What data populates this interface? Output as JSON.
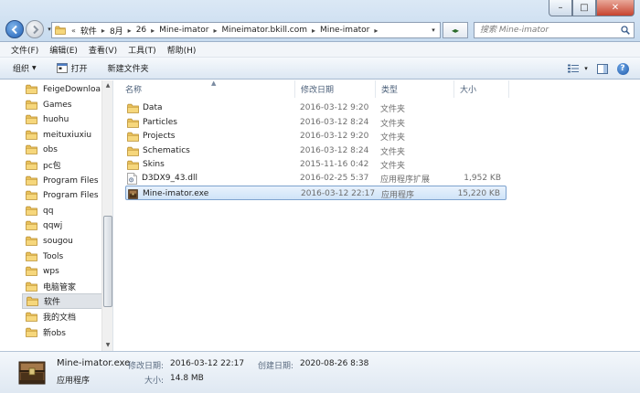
{
  "window": {
    "controls": {
      "minimize": "–",
      "maximize": "□",
      "close": "✕"
    }
  },
  "address": {
    "overflow": "«",
    "crumbs": [
      "软件",
      "8月",
      "26",
      "Mine-imator",
      "Mineimator.bkill.com",
      "Mine-imator"
    ],
    "separator": "▸",
    "dropdown": "▾"
  },
  "refresh": {
    "symbol": "◂▸"
  },
  "search": {
    "placeholder": "搜索 Mine-imator"
  },
  "menus": [
    "文件(F)",
    "编辑(E)",
    "查看(V)",
    "工具(T)",
    "帮助(H)"
  ],
  "toolbar": {
    "organize": "组织",
    "open": "打开",
    "new_folder": "新建文件夹",
    "help": "?",
    "views_dropdown": "▾"
  },
  "nav": {
    "items": [
      "FeigeDownloa",
      "Games",
      "huohu",
      "meituxiuxiu",
      "obs",
      "pc包",
      "Program Files",
      "Program Files",
      "qq",
      "qqwj",
      "sougou",
      "Tools",
      "wps",
      "电脑管家",
      "软件",
      "我的文档",
      "新obs"
    ],
    "selected_index": 14,
    "scroll_up": "▲",
    "scroll_down": "▼"
  },
  "columns": {
    "name": "名称",
    "date": "修改日期",
    "type": "类型",
    "size": "大小",
    "sort_indicator": "▲"
  },
  "files": [
    {
      "name": "Data",
      "date": "2016-03-12 9:20",
      "type": "文件夹",
      "size": "",
      "icon": "folder-icon"
    },
    {
      "name": "Particles",
      "date": "2016-03-12 8:24",
      "type": "文件夹",
      "size": "",
      "icon": "folder-icon"
    },
    {
      "name": "Projects",
      "date": "2016-03-12 9:20",
      "type": "文件夹",
      "size": "",
      "icon": "folder-icon"
    },
    {
      "name": "Schematics",
      "date": "2016-03-12 8:24",
      "type": "文件夹",
      "size": "",
      "icon": "folder-icon"
    },
    {
      "name": "Skins",
      "date": "2015-11-16 0:42",
      "type": "文件夹",
      "size": "",
      "icon": "folder-icon"
    },
    {
      "name": "D3DX9_43.dll",
      "date": "2016-02-25 5:37",
      "type": "应用程序扩展",
      "size": "1,952 KB",
      "icon": "dll-file-icon"
    },
    {
      "name": "Mine-imator.exe",
      "date": "2016-03-12 22:17",
      "type": "应用程序",
      "size": "15,220 KB",
      "icon": "exe-file-icon"
    }
  ],
  "selected_file_index": 6,
  "details": {
    "name": "Mine-imator.exe",
    "type": "应用程序",
    "modified_label": "修改日期:",
    "modified_value": "2016-03-12 22:17",
    "size_label": "大小:",
    "size_value": "14.8 MB",
    "created_label": "创建日期:",
    "created_value": "2020-08-26 8:38"
  },
  "colors": {
    "selection_fill": "#cfe3f8",
    "selection_border": "#7da2ce",
    "folder": "#e8c05a",
    "accent": "#1f5fb6"
  }
}
